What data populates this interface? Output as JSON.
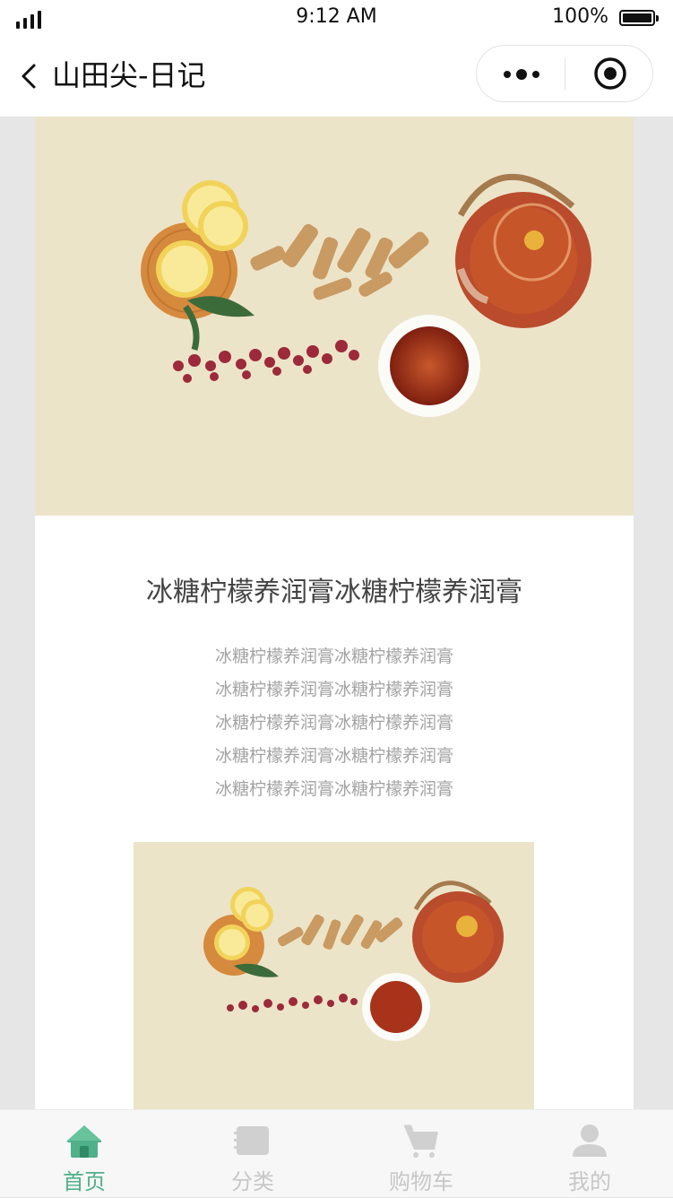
{
  "status_bar": {
    "time": "9:12 AM",
    "battery": "100%"
  },
  "nav": {
    "title": "山田尖-日记"
  },
  "article": {
    "title": "冰糖柠檬养润膏冰糖柠檬养润膏",
    "lines": [
      "冰糖柠檬养润膏冰糖柠檬养润膏",
      "冰糖柠檬养润膏冰糖柠檬养润膏",
      "冰糖柠檬养润膏冰糖柠檬养润膏",
      "冰糖柠檬养润膏冰糖柠檬养润膏",
      "冰糖柠檬养润膏冰糖柠檬养润膏"
    ]
  },
  "tabbar": {
    "items": [
      {
        "label": "首页",
        "icon": "home-icon",
        "active": true
      },
      {
        "label": "分类",
        "icon": "category-icon",
        "active": false
      },
      {
        "label": "购物车",
        "icon": "cart-icon",
        "active": false
      },
      {
        "label": "我的",
        "icon": "user-icon",
        "active": false
      }
    ]
  },
  "colors": {
    "accent": "#4fb08a",
    "inactive": "#c7c7c7",
    "hero_bg": "#ece4c9"
  }
}
